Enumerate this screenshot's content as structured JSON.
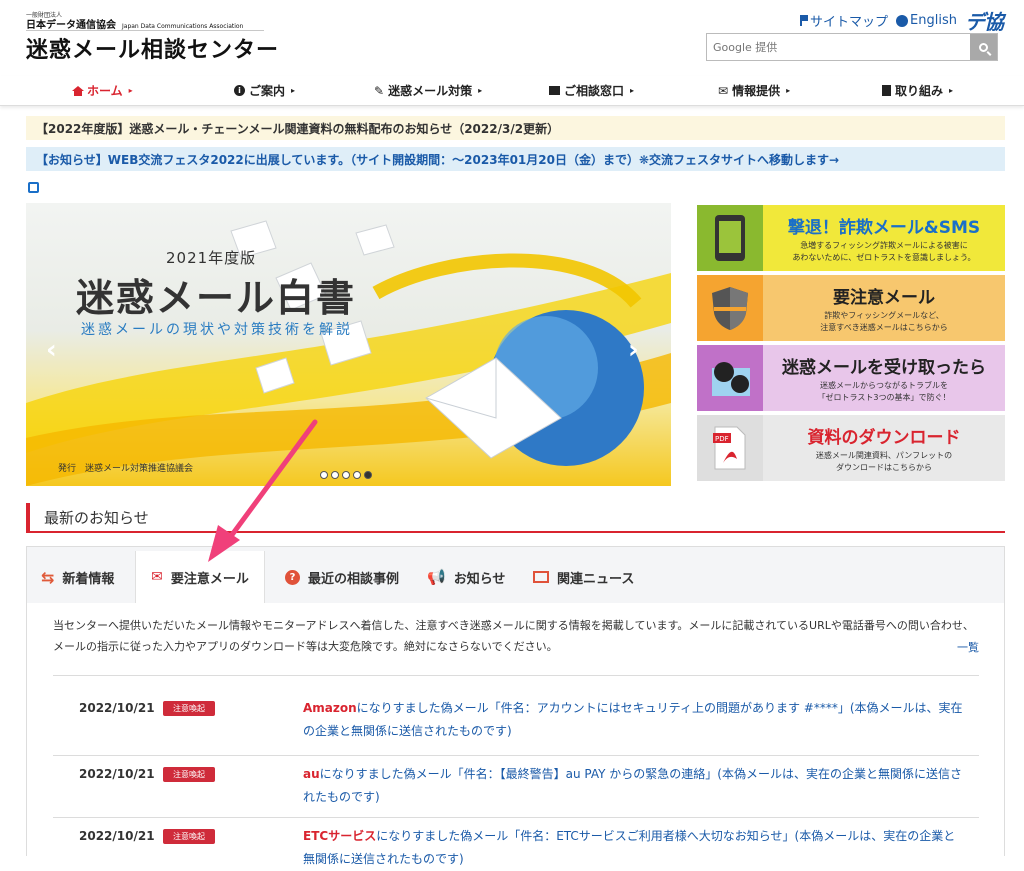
{
  "header": {
    "org_small": "一般財団法人",
    "org_name": "日本データ通信協会",
    "org_name_en": "Japan Data Communications Association",
    "site_title": "迷惑メール相談センター",
    "sitemap": "サイトマップ",
    "english": "English",
    "logo_text": "デ協",
    "search_placeholder": "Google 提供"
  },
  "nav": {
    "items": [
      {
        "label": "ホーム"
      },
      {
        "label": "ご案内"
      },
      {
        "label": "迷惑メール対策"
      },
      {
        "label": "ご相談窓口"
      },
      {
        "label": "情報提供"
      },
      {
        "label": "取り組み"
      }
    ]
  },
  "notices": {
    "n1": "【2022年度版】迷惑メール・チェーンメール関連資料の無料配布のお知らせ（2022/3/2更新）",
    "n2": "【お知らせ】WEB交流フェスタ2022に出展しています。（サイト開設期間：〜2023年01月20日（金）まで）❋交流フェスタサイトへ移動します→"
  },
  "banner": {
    "year": "2021年度版",
    "title": "迷惑メール白書",
    "subtitle": "迷惑メールの現状や対策技術を解説",
    "publisher": "発行　迷惑メール対策推進協議会",
    "slide_count": 5,
    "active_slide": 5
  },
  "cards": [
    {
      "title": "撃退！詐欺メール&SMS",
      "desc1": "急増するフィッシング詐欺メールによる被害に",
      "desc2": "あわないために、ゼロトラストを意識しましょう。"
    },
    {
      "title": "要注意メール",
      "desc1": "詐欺やフィッシングメールなど、",
      "desc2": "注意すべき迷惑メールはこちらから"
    },
    {
      "title": "迷惑メールを受け取ったら",
      "desc1": "迷惑メールからつながるトラブルを",
      "desc2": "「ゼロトラスト3つの基本」で防ぐ！"
    },
    {
      "title": "資料のダウンロード",
      "desc1": "迷惑メール関連資料、パンフレットの",
      "desc2": "ダウンロードはこちらから"
    }
  ],
  "section": {
    "heading": "最新のお知らせ"
  },
  "tabs": [
    {
      "label": "新着情報"
    },
    {
      "label": "要注意メール"
    },
    {
      "label": "最近の相談事例"
    },
    {
      "label": "お知らせ"
    },
    {
      "label": "関連ニュース"
    }
  ],
  "tab_content": {
    "intro": "当センターへ提供いただいたメール情報やモニターアドレスへ着信した、注意すべき迷惑メールに関する情報を掲載しています。メールに記載されているURLや電話番号への問い合わせ、メールの指示に従った入力やアプリのダウンロード等は大変危険です。絶対になさらないでください。",
    "more": "一覧",
    "rows": [
      {
        "date": "2022/10/21",
        "badge": "注意喚起",
        "brand": "Amazon",
        "text": "になりすました偽メール「件名：アカウントにはセキュリティ上の問題があります #****」(本偽メールは、実在の企業と無関係に送信されたものです)"
      },
      {
        "date": "2022/10/21",
        "badge": "注意喚起",
        "brand": "au",
        "text": "になりすました偽メール「件名：【最終警告】au PAY からの緊急の連絡」(本偽メールは、実在の企業と無関係に送信されたものです)"
      },
      {
        "date": "2022/10/21",
        "badge": "注意喚起",
        "brand": "ETCサービス",
        "text": "になりすました偽メール「件名：ETCサービスご利用者様へ大切なお知らせ」(本偽メールは、実在の企業と無関係に送信されたものです)"
      }
    ]
  },
  "colors": {
    "accent_red": "#d9242f",
    "link_blue": "#1a5aa8",
    "pointer_pink": "#f0407a"
  }
}
